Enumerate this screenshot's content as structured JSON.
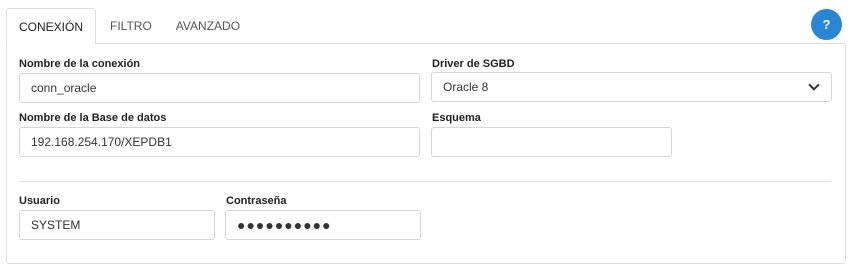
{
  "tabs": [
    {
      "label": "CONEXIÓN",
      "active": true
    },
    {
      "label": "FILTRO",
      "active": false
    },
    {
      "label": "AVANZADO",
      "active": false
    }
  ],
  "help": {
    "label": "?"
  },
  "form": {
    "connection_name": {
      "label": "Nombre de la conexión",
      "value": "conn_oracle"
    },
    "driver": {
      "label": "Driver de SGBD",
      "value": "Oracle 8"
    },
    "database_name": {
      "label": "Nombre de la Base de datos",
      "value": "192.168.254.170/XEPDB1"
    },
    "schema": {
      "label": "Esquema",
      "value": ""
    },
    "user": {
      "label": "Usuario",
      "value": "SYSTEM"
    },
    "password": {
      "label": "Contraseña",
      "value": "●●●●●●●●●●"
    }
  },
  "colors": {
    "accent": "#2a85d5",
    "border": "#d6d6d6"
  }
}
